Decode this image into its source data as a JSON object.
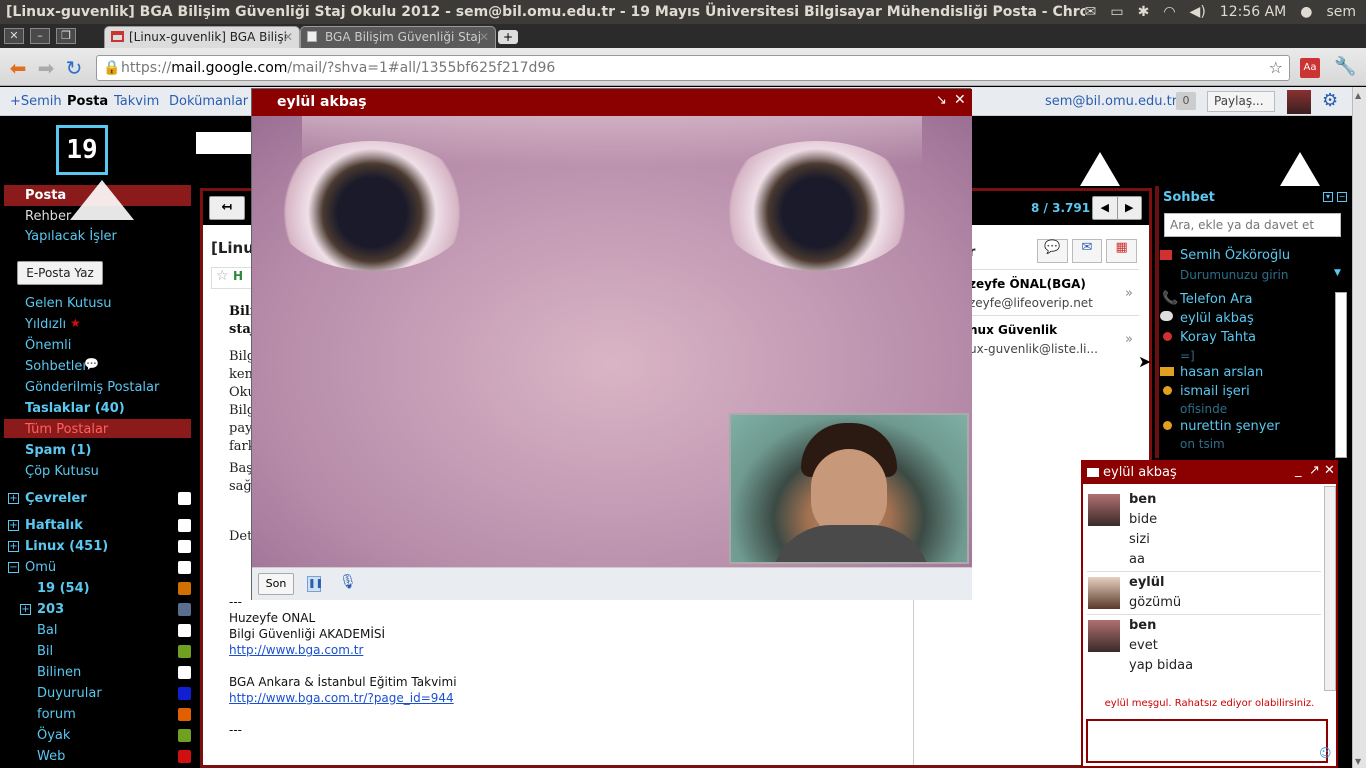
{
  "window": {
    "title": "[Linux-guvenlik] BGA Bilişim Güvenliği Staj Okulu 2012 - sem@bil.omu.edu.tr - 19 Mayıs Üniversitesi Bilgisayar Mühendisliği Posta - Chromium",
    "time": "12:56 AM",
    "user": "sem"
  },
  "tabs": [
    {
      "label": "[Linux-guvenlik] BGA Bilişi"
    },
    {
      "label": "BGA Bilişim Güvenliği Staj"
    }
  ],
  "address": {
    "scheme": "https://",
    "host": "mail.google.com",
    "path": "/mail/?shva=1#all/1355bf625f217d96"
  },
  "gbar": {
    "links": [
      "+Semih",
      "Posta",
      "Takvim",
      "Dokümanlar"
    ],
    "account": "sem@bil.omu.edu.tr",
    "count": "0",
    "share": "Paylaş..."
  },
  "sidebar": {
    "top": [
      "Posta",
      "Rehber",
      "Yapılacak İşler"
    ],
    "compose": "E-Posta Yaz",
    "folders": [
      "Gelen Kutusu",
      "Yıldızlı",
      "Önemli",
      "Sohbetler",
      "Gönderilmiş Postalar",
      "Taslaklar (40)",
      "Tüm Postalar",
      "Spam (1)",
      "Çöp Kutusu"
    ],
    "labels": [
      "Çevreler",
      "Haftalık",
      "Linux (451)",
      "Omü"
    ],
    "sublabels": [
      "19 (54)",
      "203",
      "Bal",
      "Bil",
      "Bilinen",
      "Duyurular",
      "forum",
      "Öyak",
      "Web"
    ],
    "sublabel_colors": [
      "#d07000",
      "#5a6f90",
      "#ffffff",
      "#6fa020",
      "#ffffff",
      "#1020d0",
      "#e06000",
      "#6fa020",
      "#d01010"
    ]
  },
  "email": {
    "counter": "8 / 3.791",
    "subject": "[Linu",
    "frag_lines": [
      "Bilgi",
      "kend",
      "Oku",
      "Bilg",
      "payl",
      "fark",
      "Başa",
      "sağl",
      "Deta"
    ],
    "frag_bold": [
      "Biliş",
      "staj"
    ],
    "sig": [
      "---",
      "Huzeyfe ONAL",
      "Bilgi Güvenliği AKADEMİSİ",
      "http://www.bga.com.tr",
      "BGA Ankara & İstanbul Eğitim Takvimi",
      "http://www.bga.com.tr/?page_id=944",
      "---"
    ],
    "people": [
      {
        "name": "zeyfe ÖNAL(BGA)",
        "mail": "zeyfe@lifeoverip.net"
      },
      {
        "name": "nux Güvenlik",
        "mail": "ux-guvenlik@liste.li..."
      }
    ],
    "people_label": "r"
  },
  "video": {
    "title": "eylül akbaş",
    "end_label": "Son"
  },
  "sohbet": {
    "title": "Sohbet",
    "search_placeholder": "Ara, ekle ya da davet et",
    "contacts": [
      {
        "name": "Semih Özköroğlu",
        "status": "Durumunuzu girin"
      },
      {
        "name": "Telefon Ara",
        "status": ""
      },
      {
        "name": "eylül akbaş",
        "status": ""
      },
      {
        "name": "Koray Tahta",
        "status": "=]"
      },
      {
        "name": "hasan arslan",
        "status": ""
      },
      {
        "name": "ismail işeri",
        "status": "ofisinde"
      },
      {
        "name": "nurettin şenyer",
        "status": "on tsim"
      }
    ]
  },
  "chat": {
    "title": "eylül akbaş",
    "messages": [
      {
        "who": "ben",
        "lines": [
          "bide",
          "sizi",
          "aa"
        ]
      },
      {
        "who": "eylül",
        "lines": [
          "gözümü"
        ]
      },
      {
        "who": "ben",
        "lines": [
          "evet",
          "yap bidaa"
        ]
      }
    ],
    "busy": "eylül meşgul. Rahatsız ediyor olabilirsiniz."
  }
}
